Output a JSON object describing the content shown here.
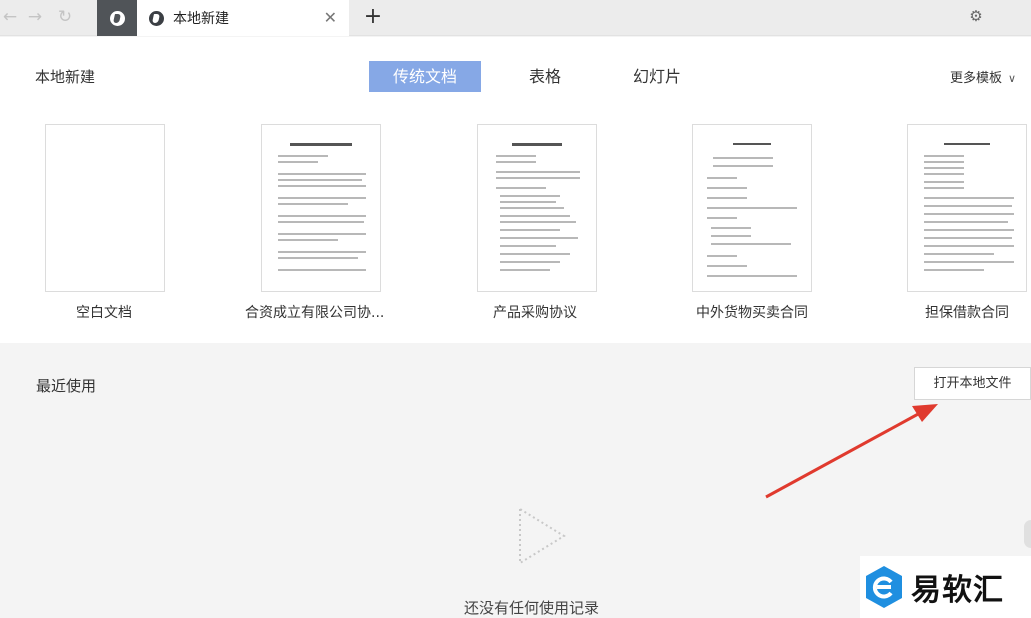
{
  "tabs": {
    "active_title": "本地新建",
    "new_tab_icon": "plus-icon",
    "close_icon": "close-icon"
  },
  "header": {
    "section_title": "本地新建",
    "type_tabs": [
      "传统文档",
      "表格",
      "幻灯片"
    ],
    "active_type": "传统文档",
    "more_templates": "更多模板"
  },
  "templates": [
    {
      "label": "空白文档"
    },
    {
      "label": "合资成立有限公司协..."
    },
    {
      "label": "产品采购协议"
    },
    {
      "label": "中外货物买卖合同"
    },
    {
      "label": "担保借款合同"
    }
  ],
  "recent": {
    "title": "最近使用",
    "open_local_button": "打开本地文件",
    "empty_text": "还没有任何使用记录"
  },
  "watermark": {
    "text": "易软汇"
  },
  "colors": {
    "active_tab_bg": "#86a8e6",
    "arrow": "#e03a2e",
    "watermark_blue": "#1f8fe0"
  }
}
